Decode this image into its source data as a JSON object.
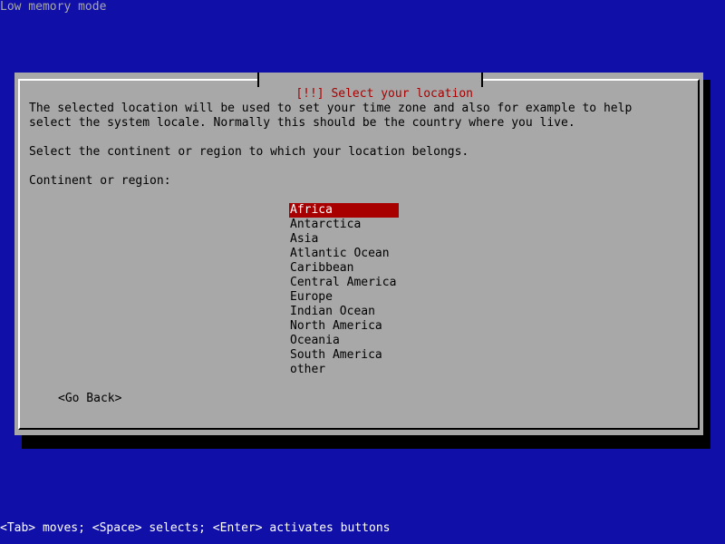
{
  "screen": {
    "top_status": "Low memory mode",
    "bottom_help": "<Tab> moves; <Space> selects; <Enter> activates buttons"
  },
  "dialog": {
    "title": "[!!] Select your location",
    "description_line_1": "The selected location will be used to set your time zone and also for example to help",
    "description_line_2": "select the system locale. Normally this should be the country where you live.",
    "prompt": "Select the continent or region to which your location belongs.",
    "field_label": "Continent or region:",
    "regions": [
      "Africa",
      "Antarctica",
      "Asia",
      "Atlantic Ocean",
      "Caribbean",
      "Central America",
      "Europe",
      "Indian Ocean",
      "North America",
      "Oceania",
      "South America",
      "other"
    ],
    "selected_region": "Africa",
    "go_back_label": "<Go Back>"
  },
  "colors": {
    "background": "#1010a8",
    "dialog": "#a8a8a8",
    "accent": "#a80000",
    "selection_text": "#ffffff",
    "help_text": "#ffffff",
    "status_text": "#a8a8a8"
  }
}
